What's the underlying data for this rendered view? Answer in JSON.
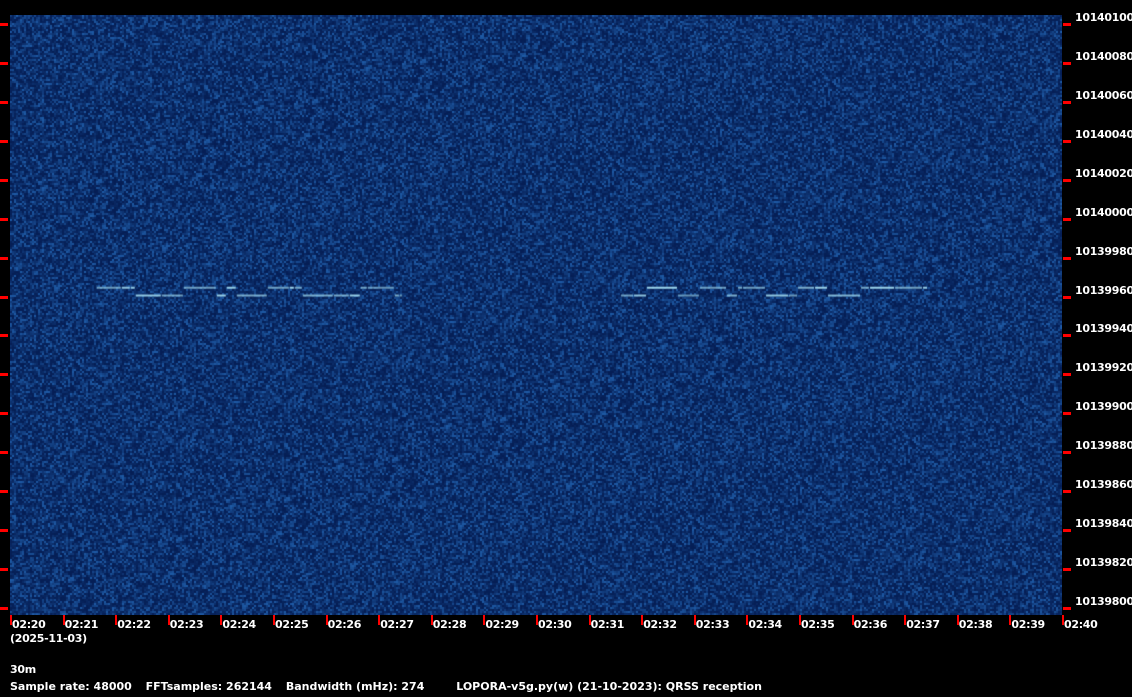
{
  "chart_data": {
    "type": "heatmap",
    "title": "",
    "x_ticks": [
      "02:20",
      "02:21",
      "02:22",
      "02:23",
      "02:24",
      "02:25",
      "02:26",
      "02:27",
      "02:28",
      "02:29",
      "02:30",
      "02:31",
      "02:32",
      "02:33",
      "02:34",
      "02:35",
      "02:36",
      "02:37",
      "02:38",
      "02:39",
      "02:40"
    ],
    "x_range": [
      "02:20",
      "02:40"
    ],
    "date": "(2025-11-03)",
    "y_ticks": [
      "10140100",
      "10140080",
      "10140060",
      "10140040",
      "10140020",
      "10140000",
      "10139980",
      "10139960",
      "10139940",
      "10139920",
      "10139900",
      "10139880",
      "10139860",
      "10139840",
      "10139820",
      "10139800"
    ],
    "y_range_hz": [
      10139796,
      10140104
    ],
    "colormap": {
      "background": "#0a2a5e",
      "signal": "#9fd8ee"
    },
    "signals": [
      {
        "start": "02:21:39",
        "end": "02:27:27",
        "freq_hz": [
          10139960,
          10139964
        ]
      },
      {
        "start": "02:31:37",
        "end": "02:37:26",
        "freq_hz": [
          10139960,
          10139964
        ]
      }
    ]
  },
  "footer": {
    "band": "30m",
    "sample_rate": "Sample rate: 48000",
    "fft_samples": "FFTsamples: 262144",
    "bandwidth": "Bandwidth (mHz): 274",
    "program": "LOPORA-v5g.py(w) (21-10-2023): QRSS reception"
  },
  "colors": {
    "tick": "#ff0000",
    "text": "#ffffff",
    "background": "#000000"
  }
}
